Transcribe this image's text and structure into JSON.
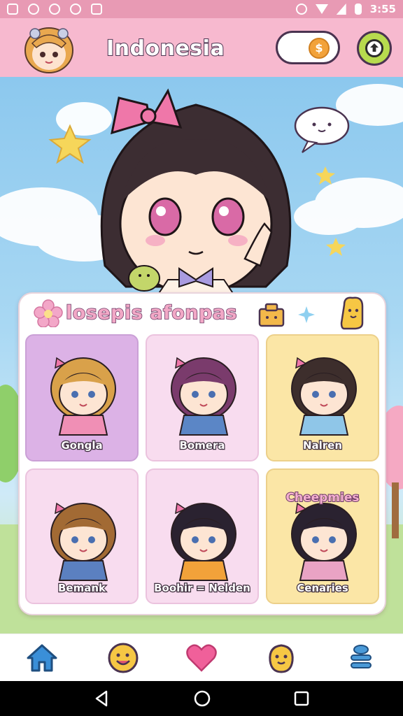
{
  "status_bar": {
    "time": "3:55",
    "icons": [
      "gallery-icon",
      "notification-6-icon",
      "notification-6b-icon",
      "clock-icon",
      "app-icon",
      "alarm-icon",
      "wifi-icon",
      "signal-icon",
      "battery-icon"
    ]
  },
  "header": {
    "title": "Indonesia",
    "coin_symbol": "$",
    "avatar_icon": "profile-avatar-icon",
    "settings_icon": "settings-icon"
  },
  "panel": {
    "title": "losepis afonpas",
    "header_icons": [
      "flower-icon",
      "gift-box-icon",
      "sparkle-icon",
      "mascot-icon"
    ],
    "characters": [
      {
        "label": "Gongla",
        "tile": "purple",
        "hair": "#d9a14a",
        "shirt": "#f08fb5"
      },
      {
        "label": "Bomera",
        "tile": "pink",
        "hair": "#7a3b6c",
        "shirt": "#5b86c6"
      },
      {
        "label": "Nalren",
        "tile": "yellow",
        "hair": "#3d2e2c",
        "shirt": "#8fc6e8"
      },
      {
        "label": "Bemank",
        "tile": "pink",
        "hair": "#a26a34",
        "shirt": "#5b80c0"
      },
      {
        "label": "Boohir = Nelden",
        "tile": "pink",
        "hair": "#2a2230",
        "shirt": "#f2a23a"
      },
      {
        "label": "Cenaries",
        "tile": "yellow",
        "hair": "#2a2230",
        "shirt": "#e9a3c4",
        "badge": "Cheepmies"
      }
    ]
  },
  "bottom_nav": {
    "items": [
      "home-icon",
      "smile-icon",
      "heart-icon",
      "chick-icon",
      "menu-stack-icon"
    ]
  },
  "colors": {
    "header_bg": "#f7b9cf",
    "status_bg": "#e89ab4",
    "accent_pink": "#ef5b8f",
    "nav_blue": "#3a8fd8"
  }
}
